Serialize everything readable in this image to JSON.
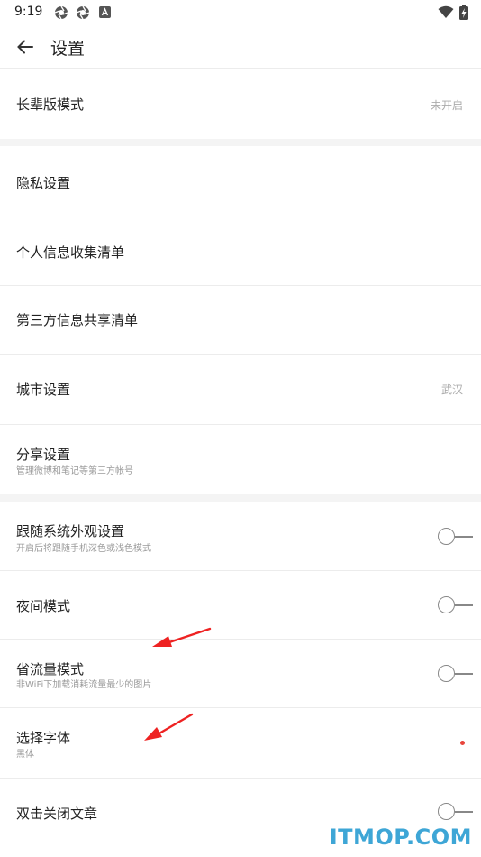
{
  "status_bar": {
    "time": "9:19",
    "icons_left": [
      "aperture-icon",
      "aperture-icon",
      "app-notification-icon"
    ],
    "icons_right": [
      "wifi-icon",
      "battery-charging-icon"
    ]
  },
  "header": {
    "title": "设置",
    "back_icon": "arrow-left-icon"
  },
  "settings": {
    "elder_mode": {
      "title": "长辈版模式",
      "value": "未开启"
    },
    "privacy": {
      "title": "隐私设置"
    },
    "personal_info": {
      "title": "个人信息收集清单"
    },
    "third_party": {
      "title": "第三方信息共享清单"
    },
    "city": {
      "title": "城市设置",
      "value": "武汉"
    },
    "share": {
      "title": "分享设置",
      "subtitle": "管理微博和笔记等第三方帐号"
    },
    "follow_system": {
      "title": "跟随系统外观设置",
      "subtitle": "开启后将跟随手机深色或浅色模式",
      "enabled": false
    },
    "night_mode": {
      "title": "夜间模式",
      "enabled": false
    },
    "data_saver": {
      "title": "省流量模式",
      "subtitle": "非WiFi下加载消耗流量最少的图片",
      "enabled": false
    },
    "font": {
      "title": "选择字体",
      "subtitle": "黑体"
    },
    "double_tap_close": {
      "title": "双击关闭文章",
      "enabled": false
    }
  },
  "watermark": {
    "text": "ITMOP.COM"
  },
  "colors": {
    "accent_red": "#e8453c",
    "watermark_blue": "#3ea6d6",
    "divider": "#ececec",
    "section_gap": "#f4f4f4"
  }
}
